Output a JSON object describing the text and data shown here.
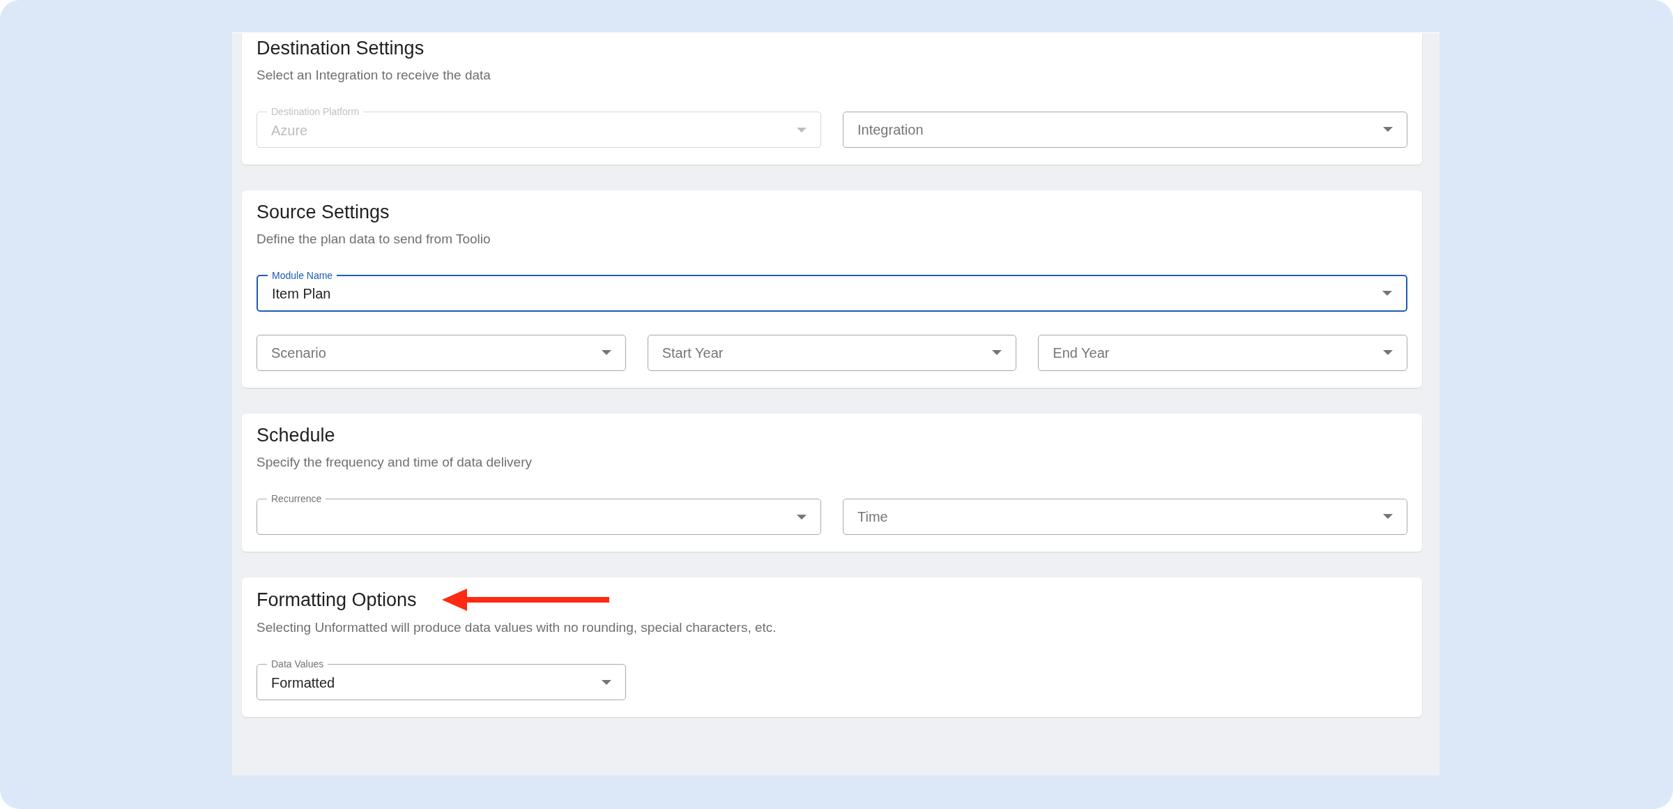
{
  "cards": [
    {
      "title": "Destination Settings",
      "subtitle": "Select an Integration to receive the data",
      "rows": [
        [
          {
            "label": "Destination Platform",
            "value": "Azure",
            "label_floating": true,
            "disabled": true,
            "focused": false
          },
          {
            "label": "Integration",
            "label_floating": false,
            "disabled": false,
            "focused": false
          }
        ]
      ]
    },
    {
      "title": "Source Settings",
      "subtitle": "Define the plan data to send from Toolio",
      "rows": [
        [
          {
            "label": "Module Name",
            "value": "Item Plan",
            "label_floating": true,
            "disabled": false,
            "focused": true
          }
        ],
        [
          {
            "label": "Scenario",
            "label_floating": false,
            "disabled": false,
            "focused": false
          },
          {
            "label": "Start Year",
            "label_floating": false,
            "disabled": false,
            "focused": false
          },
          {
            "label": "End Year",
            "label_floating": false,
            "disabled": false,
            "focused": false
          }
        ]
      ]
    },
    {
      "title": "Schedule",
      "subtitle": "Specify the frequency and time of data delivery",
      "rows": [
        [
          {
            "label": "Recurrence",
            "label_floating": true,
            "disabled": false,
            "focused": false
          },
          {
            "label": "Time",
            "label_floating": false,
            "disabled": false,
            "focused": false
          }
        ]
      ]
    },
    {
      "title": "Formatting Options",
      "subtitle": "Selecting Unformatted will produce data values with no rounding, special characters, etc.",
      "annotated": true,
      "rows": [
        [
          {
            "label": "Data Values",
            "value": "Formatted",
            "label_floating": true,
            "disabled": false,
            "focused": false
          }
        ]
      ]
    }
  ]
}
